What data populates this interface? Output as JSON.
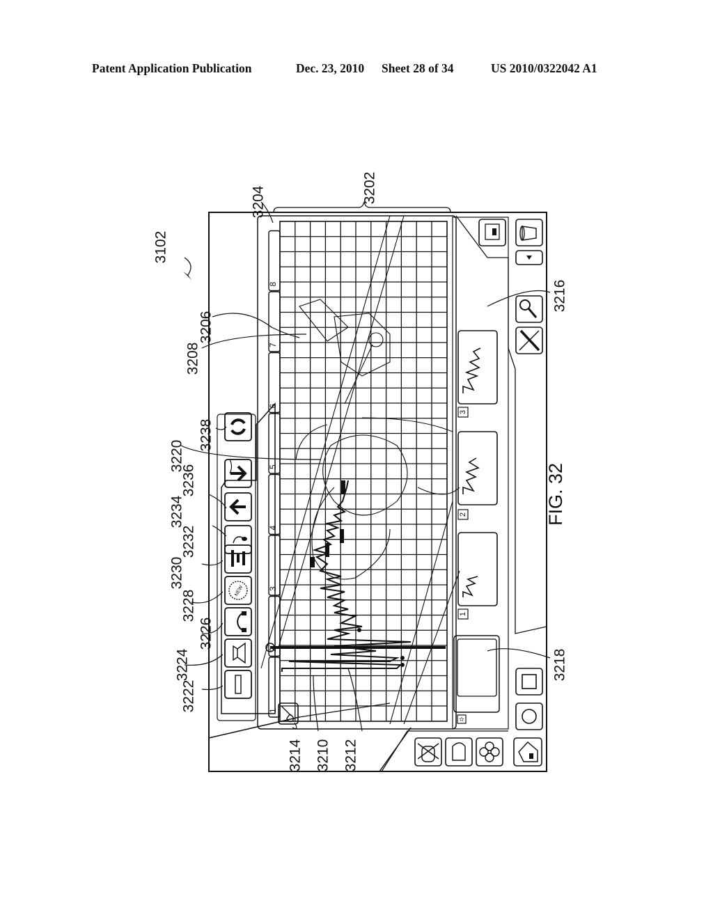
{
  "header": {
    "publication": "Patent Application Publication",
    "date": "Dec. 23, 2010",
    "sheet": "Sheet 28 of 34",
    "patent_number": "US 2010/0322042 A1"
  },
  "figure": {
    "label": "FIG. 32",
    "orientation": "rotated 90 degrees counter-clockwise",
    "reference_numerals": {
      "device": "3102",
      "display_area": "3202",
      "timeline_edge": "3204",
      "tab_marker": "3206",
      "tab_boundary": "3208",
      "waveform_left": "3210",
      "waveform_right": "3212",
      "instrument_button": "3214",
      "right_panel": "3216",
      "preview_pane": "3218",
      "background_image": "3220",
      "btn_slider": "3222",
      "btn_speaker": "3224",
      "btn_headphones": "3226",
      "btn_new": "3228",
      "btn_levels": "3230",
      "btn_note": "3232",
      "btn_back": "3234",
      "btn_forward": "3236",
      "btn_refresh": "3238"
    },
    "tabs": [
      "1",
      "2",
      "3",
      "4",
      "5",
      "6",
      "7",
      "8"
    ],
    "toolbar_buttons": [
      {
        "name": "slider",
        "icon": "slider-icon",
        "ref": "3222"
      },
      {
        "name": "speaker",
        "icon": "speaker-icon",
        "ref": "3224"
      },
      {
        "name": "headphones",
        "icon": "headphones-icon",
        "ref": "3226"
      },
      {
        "name": "new",
        "icon": "new-badge-icon",
        "ref": "3228",
        "text": "NEW"
      },
      {
        "name": "levels",
        "icon": "levels-icon",
        "ref": "3230"
      },
      {
        "name": "note",
        "icon": "music-note-icon",
        "ref": "3232"
      },
      {
        "name": "back",
        "icon": "arrow-left-icon",
        "ref": "3234"
      },
      {
        "name": "forward",
        "icon": "arrow-right-icon",
        "ref": "3236"
      },
      {
        "name": "refresh",
        "icon": "refresh-icon",
        "ref": "3238"
      }
    ],
    "thumbnails": [
      {
        "index": "1"
      },
      {
        "index": "2"
      },
      {
        "index": "3"
      }
    ],
    "right_icons": [
      "monitor-icon",
      "cup-icon",
      "dropdown-icon",
      "magnifier-icon",
      "tools-icon",
      "square-icon",
      "circle-icon"
    ],
    "bottom_icons": [
      "drum-icon",
      "bell-icon",
      "flower-icon",
      "house-icon"
    ],
    "star_badge": "star-icon"
  }
}
